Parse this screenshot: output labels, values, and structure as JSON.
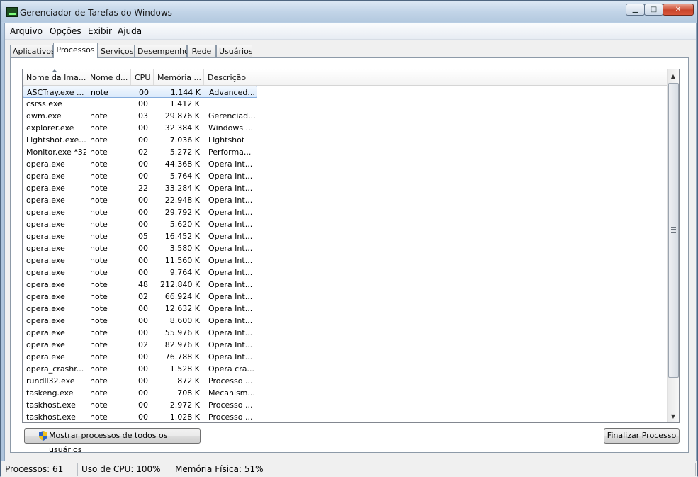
{
  "window": {
    "title": "Gerenciador de Tarefas do Windows",
    "controls": {
      "minimize": "▁",
      "maximize": "□",
      "close": "✕"
    }
  },
  "menu": [
    "Arquivo",
    "Opções",
    "Exibir",
    "Ajuda"
  ],
  "tabs": [
    "Aplicativos",
    "Processos",
    "Serviços",
    "Desempenho",
    "Rede",
    "Usuários"
  ],
  "active_tab": "Processos",
  "columns": [
    "Nome da Ima...",
    "Nome d...",
    "CPU",
    "Memória ...",
    "Descrição"
  ],
  "rows": [
    [
      "ASCTray.exe ...",
      "note",
      "00",
      "1.144 K",
      "Advanced..."
    ],
    [
      "csrss.exe",
      "",
      "00",
      "1.412 K",
      ""
    ],
    [
      "dwm.exe",
      "note",
      "03",
      "29.876 K",
      "Gerenciad..."
    ],
    [
      "explorer.exe",
      "note",
      "00",
      "32.384 K",
      "Windows ..."
    ],
    [
      "Lightshot.exe...",
      "note",
      "00",
      "7.036 K",
      "Lightshot"
    ],
    [
      "Monitor.exe *32",
      "note",
      "02",
      "5.272 K",
      "Performa..."
    ],
    [
      "opera.exe",
      "note",
      "00",
      "44.368 K",
      "Opera Int..."
    ],
    [
      "opera.exe",
      "note",
      "00",
      "5.764 K",
      "Opera Int..."
    ],
    [
      "opera.exe",
      "note",
      "22",
      "33.284 K",
      "Opera Int..."
    ],
    [
      "opera.exe",
      "note",
      "00",
      "22.948 K",
      "Opera Int..."
    ],
    [
      "opera.exe",
      "note",
      "00",
      "29.792 K",
      "Opera Int..."
    ],
    [
      "opera.exe",
      "note",
      "00",
      "5.620 K",
      "Opera Int..."
    ],
    [
      "opera.exe",
      "note",
      "05",
      "16.452 K",
      "Opera Int..."
    ],
    [
      "opera.exe",
      "note",
      "00",
      "3.580 K",
      "Opera Int..."
    ],
    [
      "opera.exe",
      "note",
      "00",
      "11.560 K",
      "Opera Int..."
    ],
    [
      "opera.exe",
      "note",
      "00",
      "9.764 K",
      "Opera Int..."
    ],
    [
      "opera.exe",
      "note",
      "48",
      "212.840 K",
      "Opera Int..."
    ],
    [
      "opera.exe",
      "note",
      "02",
      "66.924 K",
      "Opera Int..."
    ],
    [
      "opera.exe",
      "note",
      "00",
      "12.632 K",
      "Opera Int..."
    ],
    [
      "opera.exe",
      "note",
      "00",
      "8.600 K",
      "Opera Int..."
    ],
    [
      "opera.exe",
      "note",
      "00",
      "55.976 K",
      "Opera Int..."
    ],
    [
      "opera.exe",
      "note",
      "02",
      "82.976 K",
      "Opera Int..."
    ],
    [
      "opera.exe",
      "note",
      "00",
      "76.788 K",
      "Opera Int..."
    ],
    [
      "opera_crashr...",
      "note",
      "00",
      "1.528 K",
      "Opera cra..."
    ],
    [
      "rundll32.exe",
      "note",
      "00",
      "872 K",
      "Processo ..."
    ],
    [
      "taskeng.exe",
      "note",
      "00",
      "708 K",
      "Mecanism..."
    ],
    [
      "taskhost.exe",
      "note",
      "00",
      "2.972 K",
      "Processo ..."
    ],
    [
      "taskhost.exe",
      "note",
      "00",
      "1.028 K",
      "Processo ..."
    ]
  ],
  "selected_row": 0,
  "buttons": {
    "show_all": "Mostrar processos de todos os usuários",
    "end_process": "Finalizar Processo"
  },
  "status": {
    "processes": "Processos: 61",
    "cpu": "Uso de CPU: 100%",
    "memory": "Memória Física: 51%"
  },
  "icons": {
    "app": "task-manager-icon",
    "shield": "uac-shield-icon"
  }
}
